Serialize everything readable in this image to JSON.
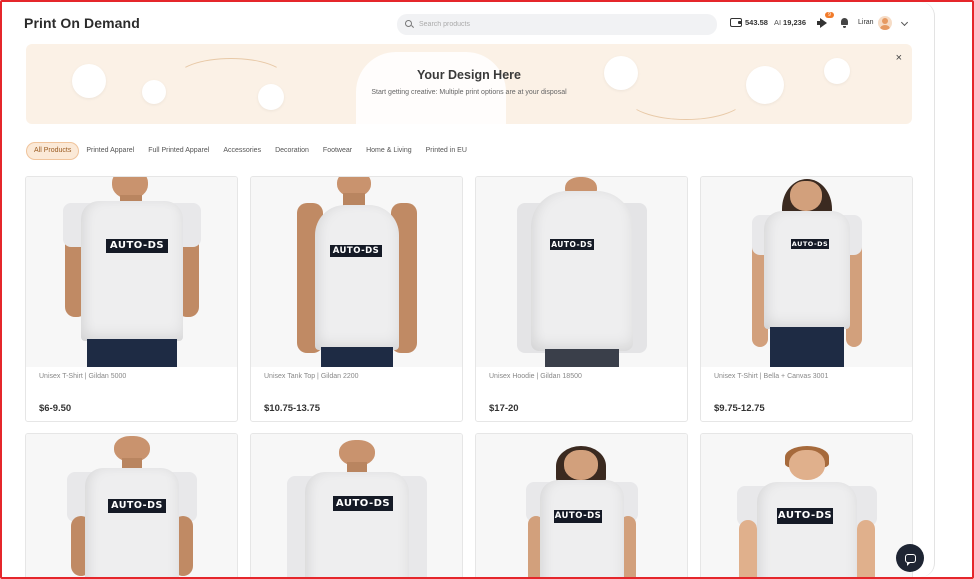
{
  "header": {
    "title": "Print On Demand",
    "search_placeholder": "Search products",
    "balance": "543.58",
    "ai_label": "AI",
    "ai_credits": "19,236",
    "notification_count": "9",
    "user_name": "Liran"
  },
  "banner": {
    "title": "Your Design Here",
    "subtitle": "Start getting creative: Multiple print options are at your disposal",
    "close": "×"
  },
  "tabs": [
    {
      "label": "All Products",
      "active": true
    },
    {
      "label": "Printed Apparel"
    },
    {
      "label": "Full Printed Apparel"
    },
    {
      "label": "Accessories"
    },
    {
      "label": "Decoration"
    },
    {
      "label": "Footwear"
    },
    {
      "label": "Home & Living"
    },
    {
      "label": "Printed in EU"
    }
  ],
  "brand_print": "AUTO-DS",
  "products": [
    {
      "title": "Unisex T-Shirt | Gildan 5000",
      "price": "$6-9.50"
    },
    {
      "title": "Unisex Tank Top | Gildan 2200",
      "price": "$10.75-13.75"
    },
    {
      "title": "Unisex Hoodie | Gildan 18500",
      "price": "$17-20"
    },
    {
      "title": "Unisex T-Shirt | Bella + Canvas 3001",
      "price": "$9.75-12.75"
    },
    {
      "title": "",
      "price": ""
    },
    {
      "title": "",
      "price": ""
    },
    {
      "title": "",
      "price": ""
    },
    {
      "title": "",
      "price": ""
    }
  ],
  "colors": {
    "accent": "#f0c49c",
    "banner_bg": "#fbf1e6",
    "logo_bg": "#151a26",
    "chat_button": "#1e2533"
  }
}
